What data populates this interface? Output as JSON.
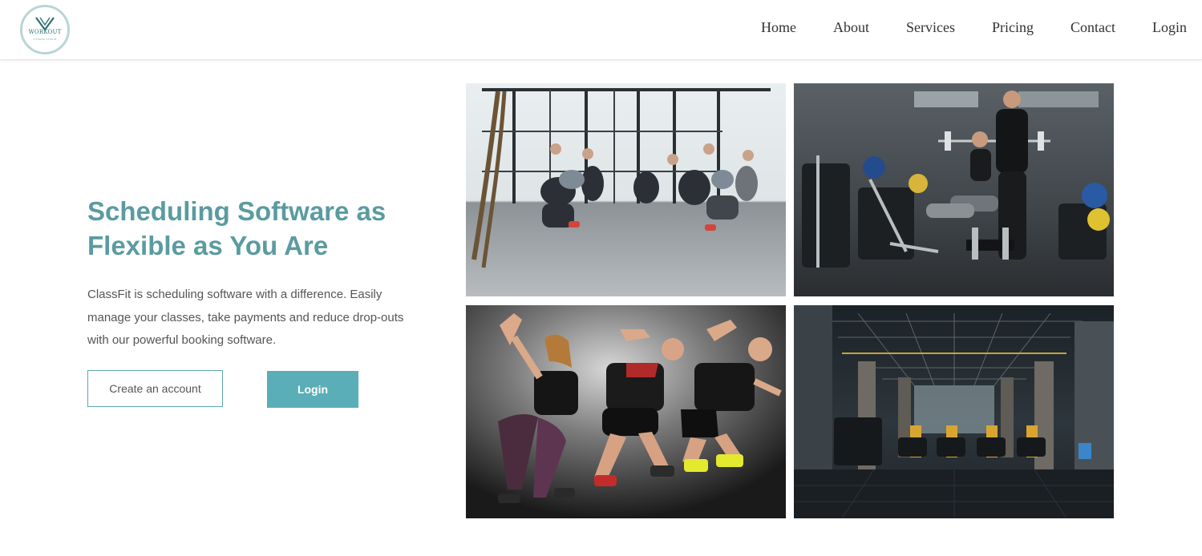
{
  "header": {
    "logo": {
      "word": "WORKOUT",
      "tagline": "FITNESS STUDIO"
    },
    "nav": [
      {
        "label": "Home"
      },
      {
        "label": "About"
      },
      {
        "label": "Services"
      },
      {
        "label": "Pricing"
      },
      {
        "label": "Contact"
      },
      {
        "label": "Login"
      }
    ]
  },
  "hero": {
    "headline": "Scheduling Software as Flexible as You Are",
    "lead": "ClassFit is scheduling software with a difference. Easily manage your classes, take payments and reduce drop-outs with our powerful booking software.",
    "buttons": {
      "create_account": "Create an account",
      "login": "Login"
    }
  },
  "gallery": [
    {
      "name": "group-squat-class-photo"
    },
    {
      "name": "personal-trainer-weights-photo"
    },
    {
      "name": "dance-workout-trio-photo"
    },
    {
      "name": "empty-gym-interior-photo"
    }
  ],
  "colors": {
    "accent": "#5aaeb7",
    "headline": "#5b9ba0",
    "body_text": "#555555",
    "nav_text": "#333333"
  }
}
